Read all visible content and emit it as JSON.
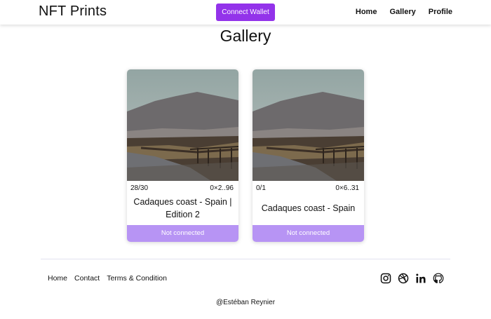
{
  "header": {
    "brand": "NFT Prints",
    "connect_label": "Connect Wallet",
    "nav": [
      "Home",
      "Gallery",
      "Profile"
    ],
    "accent_color": "#9333ea"
  },
  "page": {
    "title": "Gallery"
  },
  "cards": [
    {
      "supply": "28/30",
      "owner": "0×2..96",
      "name": "Cadaques coast - Spain | Edition 2",
      "status": "Not connected",
      "image": "landscape-photo"
    },
    {
      "supply": "0/1",
      "owner": "0×6..31",
      "name": "Cadaques coast - Spain",
      "status": "Not connected",
      "image": "landscape-photo"
    }
  ],
  "footer": {
    "links": [
      "Home",
      "Contact",
      "Terms & Condition"
    ],
    "social_icons": [
      "instagram-icon",
      "dribbble-icon",
      "linkedin-icon",
      "github-icon"
    ],
    "copyright": "@Estéban Reynier"
  },
  "colors": {
    "status_bg": "#b794f4",
    "divider": "#e3e3ef"
  }
}
